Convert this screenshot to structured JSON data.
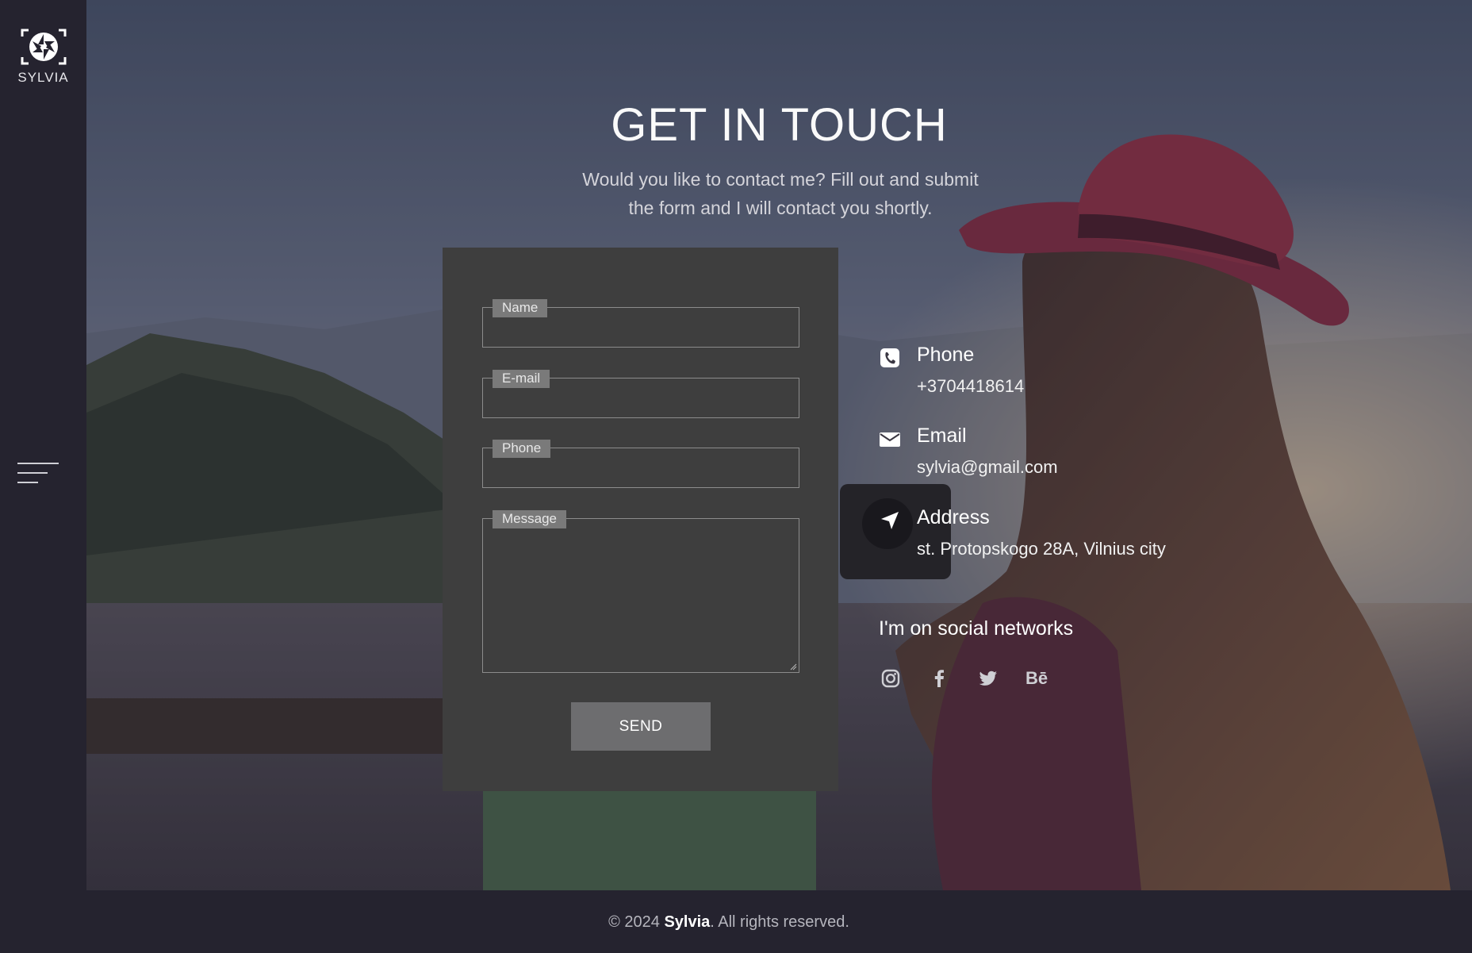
{
  "brand": {
    "name": "SYLVIA"
  },
  "header": {
    "title": "GET IN TOUCH",
    "subtitle": "Would you like to contact me? Fill out and submit the form and I will contact you shortly."
  },
  "form": {
    "fields": [
      {
        "label": "Name",
        "value": ""
      },
      {
        "label": "E-mail",
        "value": ""
      },
      {
        "label": "Phone",
        "value": ""
      },
      {
        "label": "Message",
        "value": ""
      }
    ],
    "submit_label": "SEND"
  },
  "contact": {
    "phone": {
      "title": "Phone",
      "value": "+3704418614",
      "icon": "phone-icon"
    },
    "email": {
      "title": "Email",
      "value": "sylvia@gmail.com",
      "icon": "envelope-icon"
    },
    "address": {
      "title": "Address",
      "value": "st. Protopskogo 28A, Vilnius city",
      "icon": "location-arrow-icon"
    }
  },
  "social": {
    "title": "I'm on social networks",
    "networks": [
      "instagram-icon",
      "facebook-icon",
      "twitter-icon",
      "behance-icon"
    ],
    "behance_glyph": "Bē"
  },
  "footer": {
    "prefix": "© 2024 ",
    "brand": "Sylvia",
    "suffix": ". All rights reserved."
  },
  "colors": {
    "sidebar": "#25232f",
    "form_card": "#3e3e3e",
    "label_bg": "#7a7a7a",
    "button": "#6d6d6f"
  }
}
